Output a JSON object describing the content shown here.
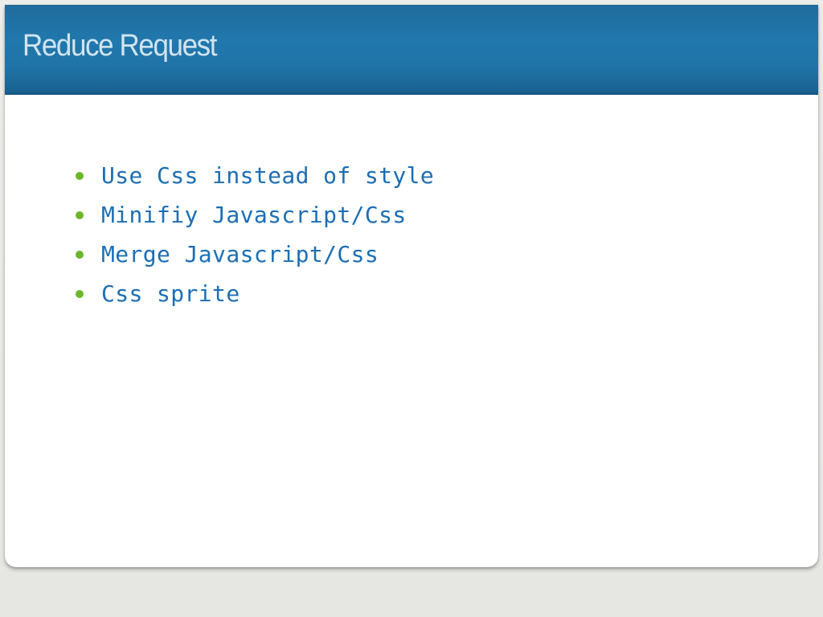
{
  "slide": {
    "title": "Reduce Request",
    "bullets": [
      "Use Css instead of style",
      "Minifiy Javascript/Css",
      "Merge Javascript/Css",
      "Css sprite"
    ]
  },
  "colors": {
    "title_bar": "#1f73a7",
    "title_text": "#d2e4f0",
    "bullet_dot": "#6cb52d",
    "bullet_text": "#1c6eb4",
    "background": "#e8e8e4"
  }
}
